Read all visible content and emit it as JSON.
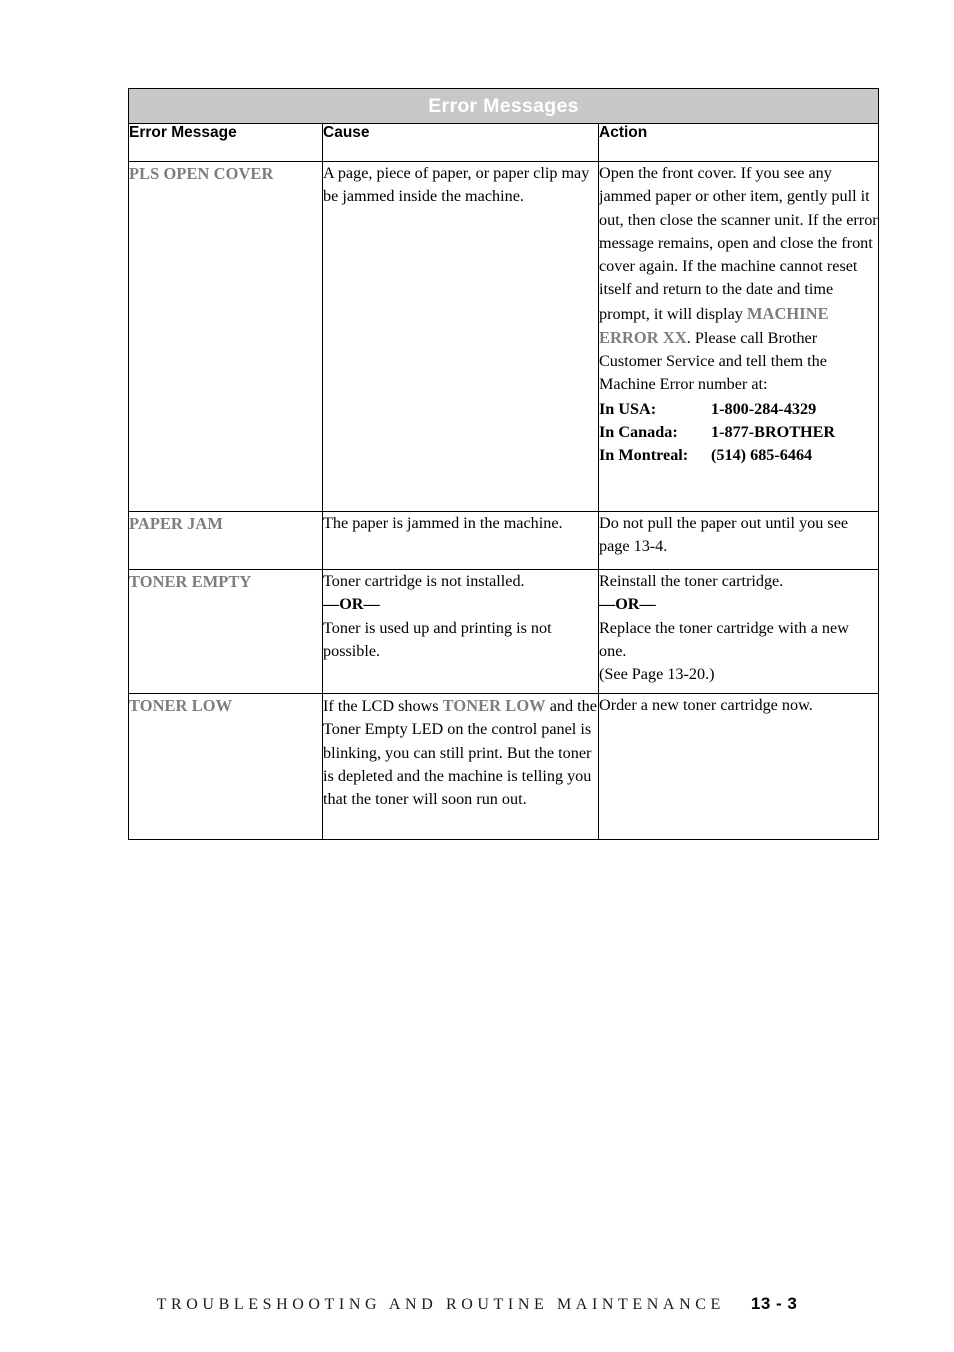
{
  "document": {
    "table": {
      "title": "Error Messages",
      "columns": [
        "Error Message",
        "Cause",
        "Action"
      ],
      "rows": [
        {
          "code": "PLS OPEN COVER",
          "cause": "A page, piece of paper, or paper clip may be jammed inside the machine.",
          "action_before": "Open the front cover. If you see any jammed paper or other item, gently pull it out, then close the scanner unit. If the error message remains, open and close the front cover again. If the machine cannot reset itself and return to the date and time prompt, it will display ",
          "action_highlight": "MACHINE ERROR XX",
          "action_after": ". Please call Brother Customer Service and tell them the Machine Error number at:",
          "phones": [
            {
              "label": "In USA:",
              "number": "1-800-284-4329"
            },
            {
              "label": "In Canada:",
              "number": "1-877-BROTHER"
            },
            {
              "label": "In Montreal:",
              "number": "(514) 685-6464"
            }
          ]
        },
        {
          "code": "PAPER JAM",
          "cause": "The paper is jammed in the machine.",
          "action": "Do not pull the paper out until you see page 13-4."
        },
        {
          "code": "TONER EMPTY",
          "cause_first": "Toner cartridge is not installed.",
          "cause_or": "—OR—",
          "cause_second": "Toner is used up and printing is not possible.",
          "action_first": "Reinstall the toner cartridge.",
          "action_or": "—OR—",
          "action_second": "Replace the toner cartridge with a new one.",
          "action_third": "(See Page 13-20.)"
        },
        {
          "code": "TONER LOW",
          "cause_before": "If the LCD shows ",
          "cause_highlight": "TONER LOW",
          "cause_after": " and the Toner Empty LED on the control panel is blinking, you can still print.  But the toner is depleted and the machine is telling you that the toner will soon run out.",
          "action": "Order a new toner cartridge now."
        }
      ]
    },
    "footer": {
      "title": "TROUBLESHOOTING AND ROUTINE MAINTENANCE",
      "page": "13 - 3"
    }
  },
  "colors": {
    "title_band_bg": "#c8c8c8",
    "title_text": "#ffffff",
    "code_text": "#7d7d7d",
    "body_text": "#000000",
    "border": "#000000"
  }
}
